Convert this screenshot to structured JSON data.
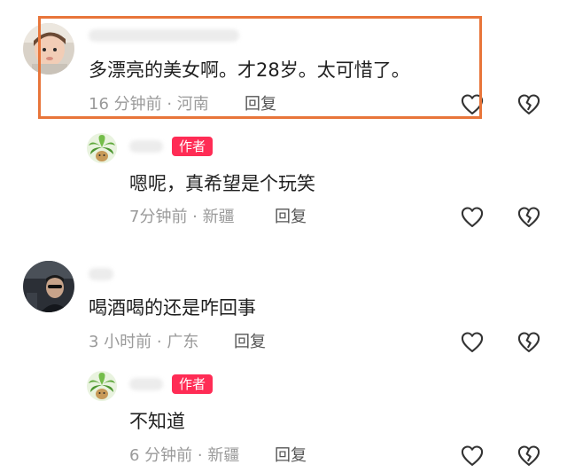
{
  "comments": [
    {
      "text": "多漂亮的美女啊。才28岁。太可惜了。",
      "time_location": "16 分钟前 · 河南",
      "reply_label": "回复",
      "is_author": false,
      "highlighted": true
    },
    {
      "text": "嗯呢，真希望是个玩笑",
      "time_location": "7分钟前 · 新疆",
      "reply_label": "回复",
      "is_author": true,
      "author_badge": "作者"
    },
    {
      "text": "喝酒喝的还是咋回事",
      "time_location": "3 小时前 · 广东",
      "reply_label": "回复",
      "is_author": false
    },
    {
      "text": "不知道",
      "time_location": "6 分钟前 · 新疆",
      "reply_label": "回复",
      "is_author": true,
      "author_badge": "作者"
    }
  ],
  "colors": {
    "highlight_border": "#e8753a",
    "author_badge": "#ff2c55",
    "meta_text": "#9a9a9a"
  },
  "icons": {
    "like": "heart-outline-icon",
    "dislike": "broken-heart-outline-icon"
  }
}
